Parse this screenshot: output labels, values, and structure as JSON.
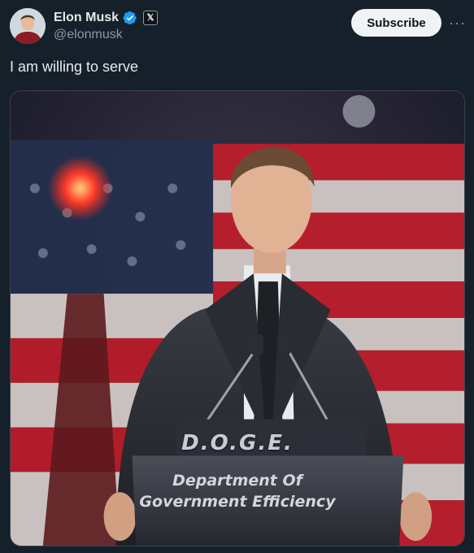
{
  "author": {
    "display_name": "Elon Musk",
    "handle": "@elonmusk",
    "affiliate_badge": "𝕏"
  },
  "actions": {
    "subscribe_label": "Subscribe",
    "more_label": "···"
  },
  "tweet": {
    "text": "I am willing to serve"
  },
  "media": {
    "sign_abbreviation": "D.O.G.E.",
    "sign_line_1": "Department Of",
    "sign_line_2": "Government Efficiency"
  },
  "colors": {
    "background": "#15202b",
    "verified": "#1d9bf0",
    "subscribe_bg": "#eff3f4"
  },
  "icons": [
    "verified-badge-icon",
    "x-affiliate-icon",
    "more-icon"
  ]
}
